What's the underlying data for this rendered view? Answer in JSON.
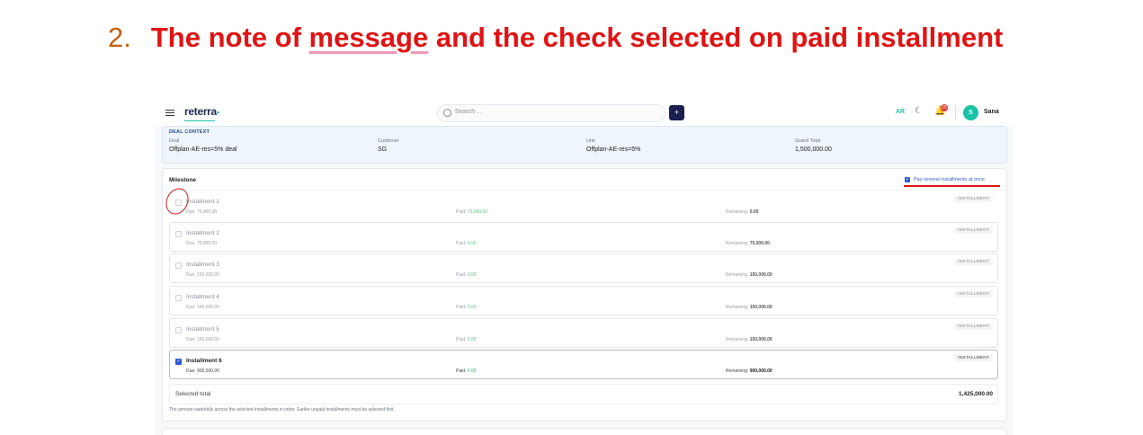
{
  "heading": {
    "number": "2.",
    "text_before": "The note of ",
    "text_underlined": "message",
    "text_after": " and the check selected on paid installment"
  },
  "topbar": {
    "logo": "reterra",
    "logo_dot": "•",
    "search_placeholder": "Search ...",
    "plus_label": "+",
    "lang": "AR",
    "moon_glyph": "☾",
    "bell_glyph": "🔔",
    "notification_count": "15",
    "avatar_initial": "S",
    "user_name": "Sana"
  },
  "deal_context": {
    "title": "DEAL CONTEXT",
    "fields": [
      {
        "label": "Deal",
        "value": "Offplan-AE-res=5% deal"
      },
      {
        "label": "Customer",
        "value": "SG"
      },
      {
        "label": "Unit",
        "value": "Offplan-AE-res=5%"
      },
      {
        "label": "Grand Total",
        "value": "1,500,000.00"
      }
    ]
  },
  "milestone": {
    "title": "Milestone",
    "pay_several_label": "Pay several installments at once",
    "pay_several_checked": true,
    "check_glyph": "✓",
    "due_prefix": "Due: ",
    "paid_prefix": "Paid: ",
    "remaining_prefix": "Remaining: ",
    "installments": [
      {
        "name": "Installment 1",
        "due": "75,000.00",
        "paid": "75,000.00",
        "remaining": "0.00",
        "tag": "INSTALLMENT",
        "selected": false
      },
      {
        "name": "Installment 2",
        "due": "75,000.00",
        "paid": "0.00",
        "remaining": "75,000.00",
        "tag": "INSTALLMENT",
        "selected": false
      },
      {
        "name": "Installment 3",
        "due": "150,000.00",
        "paid": "0.00",
        "remaining": "150,000.00",
        "tag": "INSTALLMENT",
        "selected": false
      },
      {
        "name": "Installment 4",
        "due": "150,000.00",
        "paid": "0.00",
        "remaining": "150,000.00",
        "tag": "INSTALLMENT",
        "selected": false
      },
      {
        "name": "Installment 5",
        "due": "150,000.00",
        "paid": "0.00",
        "remaining": "150,000.00",
        "tag": "INSTALLMENT",
        "selected": false
      },
      {
        "name": "Installment 6",
        "due": "900,000.00",
        "paid": "0.00",
        "remaining": "900,000.00",
        "tag": "INSTALLMENT",
        "selected": true
      }
    ],
    "selected_total_label": "Selected total",
    "selected_total_value": "1,425,000.00",
    "note": "The amount waterfalls across the selected installments in order. Earlier unpaid installments must be selected first."
  },
  "colors": {
    "heading_number": "#c45d0f",
    "heading_text": "#e01414",
    "accent": "#18c3a5",
    "navy": "#1a1f4e",
    "checkbox": "#2f5bd3",
    "paid_green": "#2db35a",
    "annotation_red": "#d91a1a"
  }
}
